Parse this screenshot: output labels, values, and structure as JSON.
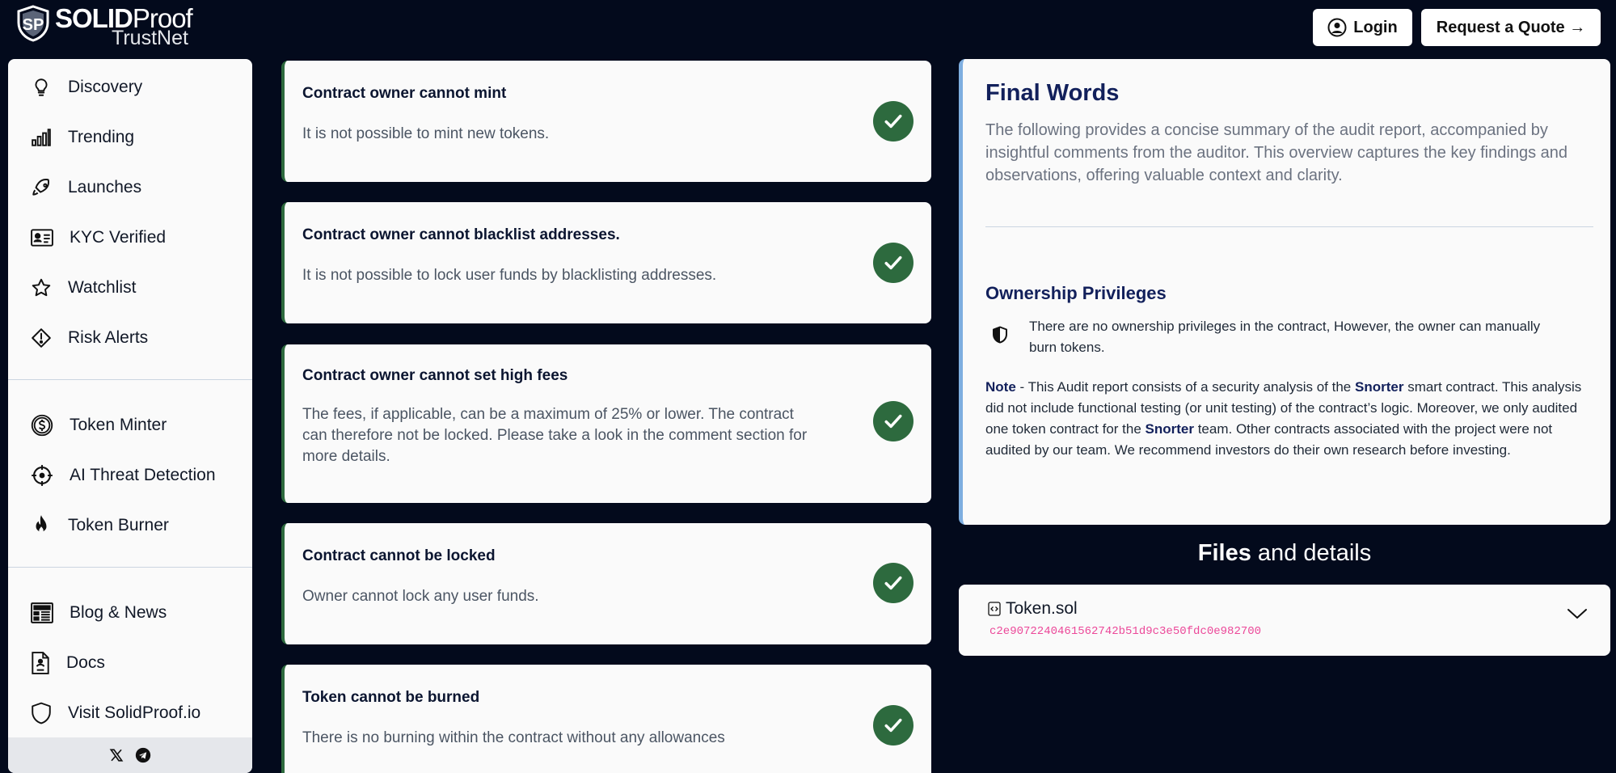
{
  "brand": {
    "name_bold": "SOLID",
    "name_light": "Proof",
    "sub": "TrustNet"
  },
  "header": {
    "login_label": "Login",
    "quote_label": "Request a Quote →"
  },
  "sidebar": {
    "items": [
      {
        "label": "Discovery",
        "icon": "lightbulb-icon"
      },
      {
        "label": "Trending",
        "icon": "bar-chart-icon"
      },
      {
        "label": "Launches",
        "icon": "rocket-icon"
      },
      {
        "label": "KYC Verified",
        "icon": "id-card-icon"
      },
      {
        "label": "Watchlist",
        "icon": "star-icon"
      },
      {
        "label": "Risk Alerts",
        "icon": "alert-diamond-icon"
      },
      {
        "label": "Token Minter",
        "icon": "dollar-coin-icon"
      },
      {
        "label": "AI Threat Detection",
        "icon": "crosshair-icon"
      },
      {
        "label": "Token Burner",
        "icon": "flame-icon"
      },
      {
        "label": "Blog & News",
        "icon": "newspaper-icon"
      },
      {
        "label": "Docs",
        "icon": "document-icon"
      },
      {
        "label": "Visit SolidProof.io",
        "icon": "shield-icon"
      }
    ],
    "footer_icons": [
      "x-icon",
      "telegram-icon"
    ]
  },
  "checks": [
    {
      "title": "Contract owner cannot mint",
      "desc": "It is not possible to mint new tokens."
    },
    {
      "title": "Contract owner cannot blacklist addresses.",
      "desc": "It is not possible to lock user funds by blacklisting addresses."
    },
    {
      "title": "Contract owner cannot set high fees",
      "desc": "The fees, if applicable, can be a maximum of 25% or lower. The contract can therefore not be locked. Please take a look in the comment section for more details."
    },
    {
      "title": "Contract cannot be locked",
      "desc": "Owner cannot lock any user funds."
    },
    {
      "title": "Token cannot be burned",
      "desc": "There is no burning within the contract without any allowances"
    }
  ],
  "final_words": {
    "title": "Final Words",
    "intro": "The following provides a concise summary of the audit report, accompanied by insightful comments from the auditor. This overview captures the key findings and observations, offering valuable context and clarity.",
    "ownership_title": "Ownership Privileges",
    "ownership_text": "There are no ownership privileges in the contract, However, the owner can manually burn tokens.",
    "note_label": "Note",
    "note_p1": " - This Audit report consists of a security analysis of the ",
    "project": "Snorter",
    "note_p2": " smart contract. This analysis did not include functional testing (or unit testing) of the contract’s logic. Moreover, we only audited one token contract for the ",
    "note_p3": " team. Other contracts associated with the project were not audited by our team. We recommend investors do their own research before investing."
  },
  "files": {
    "title_bold": "Files",
    "title_rest": " and details",
    "items": [
      {
        "name": "Token.sol",
        "hash": "c2e9072240461562742b51d9c3e50fdc0e982700"
      }
    ]
  },
  "colors": {
    "background": "#030a1c",
    "check_green": "#2d6a3e",
    "heading_navy": "#12205b",
    "hash_pink": "#ec4899",
    "final_border": "#7eaee0"
  }
}
